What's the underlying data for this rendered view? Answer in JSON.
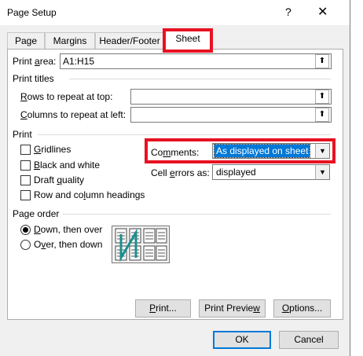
{
  "window": {
    "title": "Page Setup",
    "help_glyph": "?",
    "close_glyph": "✕"
  },
  "tabs": [
    {
      "label": "Page",
      "active": false
    },
    {
      "label": "Margins",
      "active": false
    },
    {
      "label": "Header/Footer",
      "active": false
    },
    {
      "label": "Sheet",
      "active": true
    }
  ],
  "print_area": {
    "label_prefix": "Print ",
    "label_key": "a",
    "label_suffix": "rea:",
    "value": "A1:H15"
  },
  "print_titles": {
    "heading": "Print titles",
    "rows": {
      "key": "R",
      "label": "ows to repeat at top:",
      "value": ""
    },
    "columns": {
      "key": "C",
      "label": "olumns to repeat at left:",
      "value": ""
    }
  },
  "print": {
    "heading": "Print",
    "options": {
      "gridlines": {
        "key": "G",
        "label": "ridlines",
        "checked": false
      },
      "black_white": {
        "key": "B",
        "label": "lack and white",
        "checked": false
      },
      "draft": {
        "prefix": "Draft ",
        "key": "q",
        "label": "uality",
        "checked": false
      },
      "headings": {
        "prefix": "Row and co",
        "key": "l",
        "label": "umn headings",
        "checked": false
      }
    },
    "comments": {
      "prefix": "Co",
      "key": "m",
      "label": "ments:",
      "value": "As displayed on sheet"
    },
    "cell_errors": {
      "prefix": "Cell ",
      "key": "e",
      "label": "rrors as:",
      "value": "displayed"
    }
  },
  "page_order": {
    "heading": "Page order",
    "down_over": {
      "key": "D",
      "label": "own, then over",
      "selected": true
    },
    "over_down": {
      "prefix": "O",
      "key": "v",
      "label": "er, then down",
      "selected": false
    }
  },
  "buttons": {
    "print": {
      "key": "P",
      "label": "rint..."
    },
    "print_preview": {
      "prefix": "Print Previe",
      "key": "w",
      "label": ""
    },
    "options": {
      "key": "O",
      "label": "ptions..."
    },
    "ok": "OK",
    "cancel": "Cancel"
  },
  "icons": {
    "collapse": "collapse-dialog-icon",
    "dropdown": "chevron-down-icon"
  },
  "colors": {
    "highlight_outline": "#e81123",
    "selection": "#0078d7",
    "default_button_border": "#0078d7"
  }
}
